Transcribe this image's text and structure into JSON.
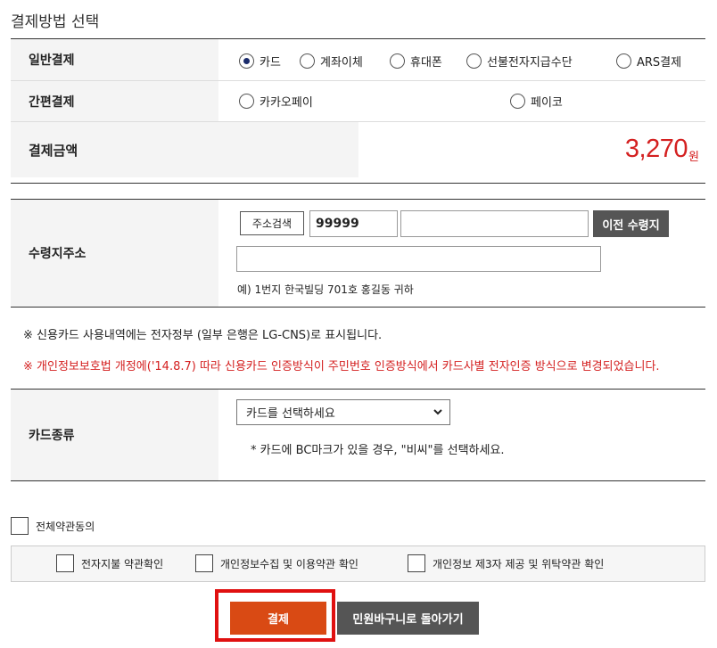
{
  "title": "결제방법 선택",
  "payment": {
    "general_label": "일반결제",
    "general_options": [
      "카드",
      "계좌이체",
      "휴대폰",
      "선불전자지급수단",
      "ARS결제"
    ],
    "selected_general": "카드",
    "simple_label": "간편결제",
    "simple_options": [
      "카카오페이",
      "페이코"
    ],
    "amount_label": "결제금액",
    "amount": "3,270",
    "amount_unit": "원"
  },
  "address": {
    "label": "수령지주소",
    "search_button": "주소검색",
    "zipcode": "99999",
    "address2": "",
    "detail": "",
    "previous_button": "이전 수령지",
    "example": "예) 1번지 한국빌딩 701호 홍길동 귀하"
  },
  "notices": {
    "note1": "※ 신용카드 사용내역에는 전자정부 (일부 은행은 LG-CNS)로 표시됩니다.",
    "note2": "※ 개인정보보호법 개정에('14.8.7) 따라 신용카드 인증방식이 주민번호 인증방식에서 카드사별 전자인증 방식으로 변경되었습니다."
  },
  "card": {
    "label": "카드종류",
    "select_value": "카드를 선택하세요",
    "hint": "* 카드에 BC마크가 있을 경우, \"비씨\"를 선택하세요."
  },
  "agreements": {
    "all": "전체약관동의",
    "items": [
      "전자지불 약관확인",
      "개인정보수집 및 이용약관 확인",
      "개인정보 제3자 제공 및 위탁약관 확인"
    ]
  },
  "actions": {
    "pay": "결제",
    "back": "민원바구니로 돌아가기"
  },
  "colors": {
    "accent": "#d94a14",
    "amount": "#d42020",
    "highlight_frame": "#e01010",
    "dark_button": "#555555"
  }
}
